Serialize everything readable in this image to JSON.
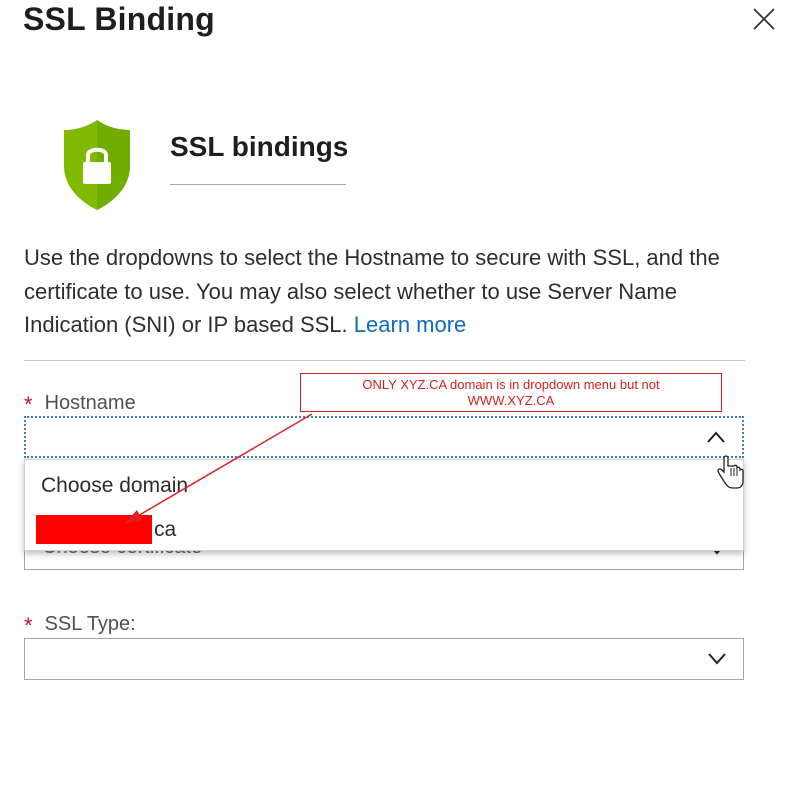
{
  "panel": {
    "title": "SSL Binding"
  },
  "section": {
    "title": "SSL bindings"
  },
  "description": {
    "text": "Use the dropdowns to select the Hostname to secure with SSL, and the certificate to use. You may also select whether to use Server Name Indication (SNI) or IP based SSL.",
    "link_label": "Learn more"
  },
  "fields": {
    "required_marker": "*",
    "hostname": {
      "label": "Hostname",
      "value": ""
    },
    "certificate": {
      "placeholder": "Choose certificate"
    },
    "ssl_type": {
      "label": "SSL Type:",
      "value": ""
    }
  },
  "hostname_dropdown": {
    "options": [
      {
        "label": "Choose domain"
      },
      {
        "label": "ca"
      }
    ]
  },
  "annotation": {
    "line1": "ONLY  XYZ.CA domain is in dropdown menu but not",
    "line2": "WWW.XYZ.CA"
  },
  "icons": {
    "close": "close-icon",
    "shield": "shield-lock-icon",
    "chevron_up": "chevron-up-icon",
    "chevron_down": "chevron-down-icon",
    "cursor": "hand-cursor-icon"
  },
  "colors": {
    "shield_green": "#7fba00",
    "link": "#0f6cbd",
    "required": "#c8102e",
    "annotation_red": "#d42020",
    "redaction": "#ff0000"
  }
}
